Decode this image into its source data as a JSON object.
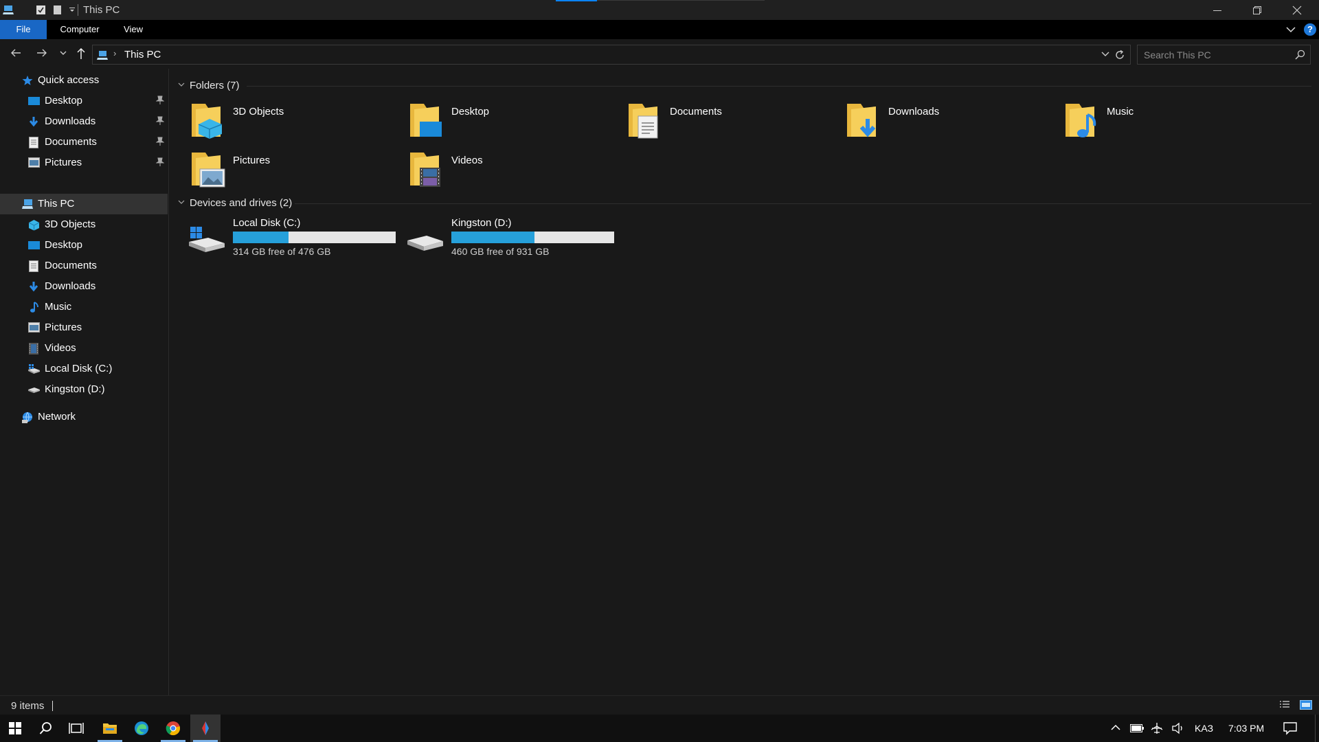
{
  "window": {
    "title": "This PC"
  },
  "ribbon": {
    "tabs": [
      "File",
      "Computer",
      "View"
    ],
    "help_label": "?"
  },
  "address": {
    "crumb": "This PC",
    "separator": "›"
  },
  "search": {
    "placeholder": "Search This PC"
  },
  "nav": {
    "quick_access": "Quick access",
    "quick_items": [
      "Desktop",
      "Downloads",
      "Documents",
      "Pictures"
    ],
    "this_pc": "This PC",
    "pc_items": [
      "3D Objects",
      "Desktop",
      "Documents",
      "Downloads",
      "Music",
      "Pictures",
      "Videos",
      "Local Disk (C:)",
      "Kingston (D:)"
    ],
    "network": "Network"
  },
  "folders": {
    "header": "Folders (7)",
    "items": [
      "3D Objects",
      "Desktop",
      "Documents",
      "Downloads",
      "Music",
      "Pictures",
      "Videos"
    ]
  },
  "drives": {
    "header": "Devices and drives (2)",
    "items": [
      {
        "name": "Local Disk (C:)",
        "free_text": "314 GB free of 476 GB",
        "used_fraction": 0.34
      },
      {
        "name": "Kingston (D:)",
        "free_text": "460 GB free of 931 GB",
        "used_fraction": 0.51
      }
    ]
  },
  "status": {
    "item_count": "9 items"
  },
  "taskbar": {
    "language": "KAЗ",
    "clock": "7:03 PM"
  },
  "colors": {
    "accent": "#1967c5",
    "drive_bar": "#26a0da",
    "folder": "#f4c542"
  }
}
